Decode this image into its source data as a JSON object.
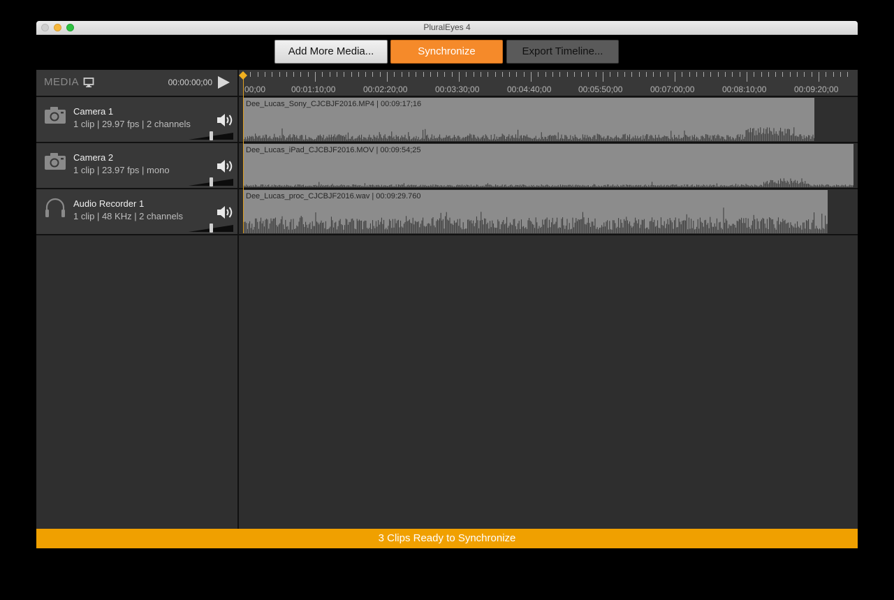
{
  "window": {
    "title": "PluralEyes 4"
  },
  "toolbar": {
    "add_label": "Add More Media...",
    "sync_label": "Synchronize",
    "export_label": "Export Timeline..."
  },
  "media": {
    "label": "MEDIA",
    "time": "00:00:00;00"
  },
  "tracks": [
    {
      "name": "Camera 1",
      "meta": "1 clip  |  29.97 fps  |  2 channels",
      "icon": "camera-icon",
      "clip_label": "Dee_Lucas_Sony_CJCBJF2016.MP4 | 00:09:17;16"
    },
    {
      "name": "Camera 2",
      "meta": "1 clip  |  23.97 fps  |  mono",
      "icon": "camera-icon",
      "clip_label": "Dee_Lucas_iPad_CJCBJF2016.MOV | 00:09:54;25"
    },
    {
      "name": "Audio Recorder 1",
      "meta": "1 clip  |  48 KHz  |  2 channels",
      "icon": "headphones-icon",
      "clip_label": "Dee_Lucas_proc_CJCBJF2016.wav | 00:09:29.760"
    }
  ],
  "ruler": {
    "labels": [
      "00;00",
      "00:01:10;00",
      "00:02:20;00",
      "00:03:30;00",
      "00:04:40;00",
      "00:05:50;00",
      "00:07:00;00",
      "00:08:10;00",
      "00:09:20;00"
    ]
  },
  "status": {
    "text": "3 Clips Ready to Synchronize"
  },
  "colors": {
    "accent": "#f58a2a",
    "status": "#f0a000",
    "playhead": "#e0a020"
  }
}
